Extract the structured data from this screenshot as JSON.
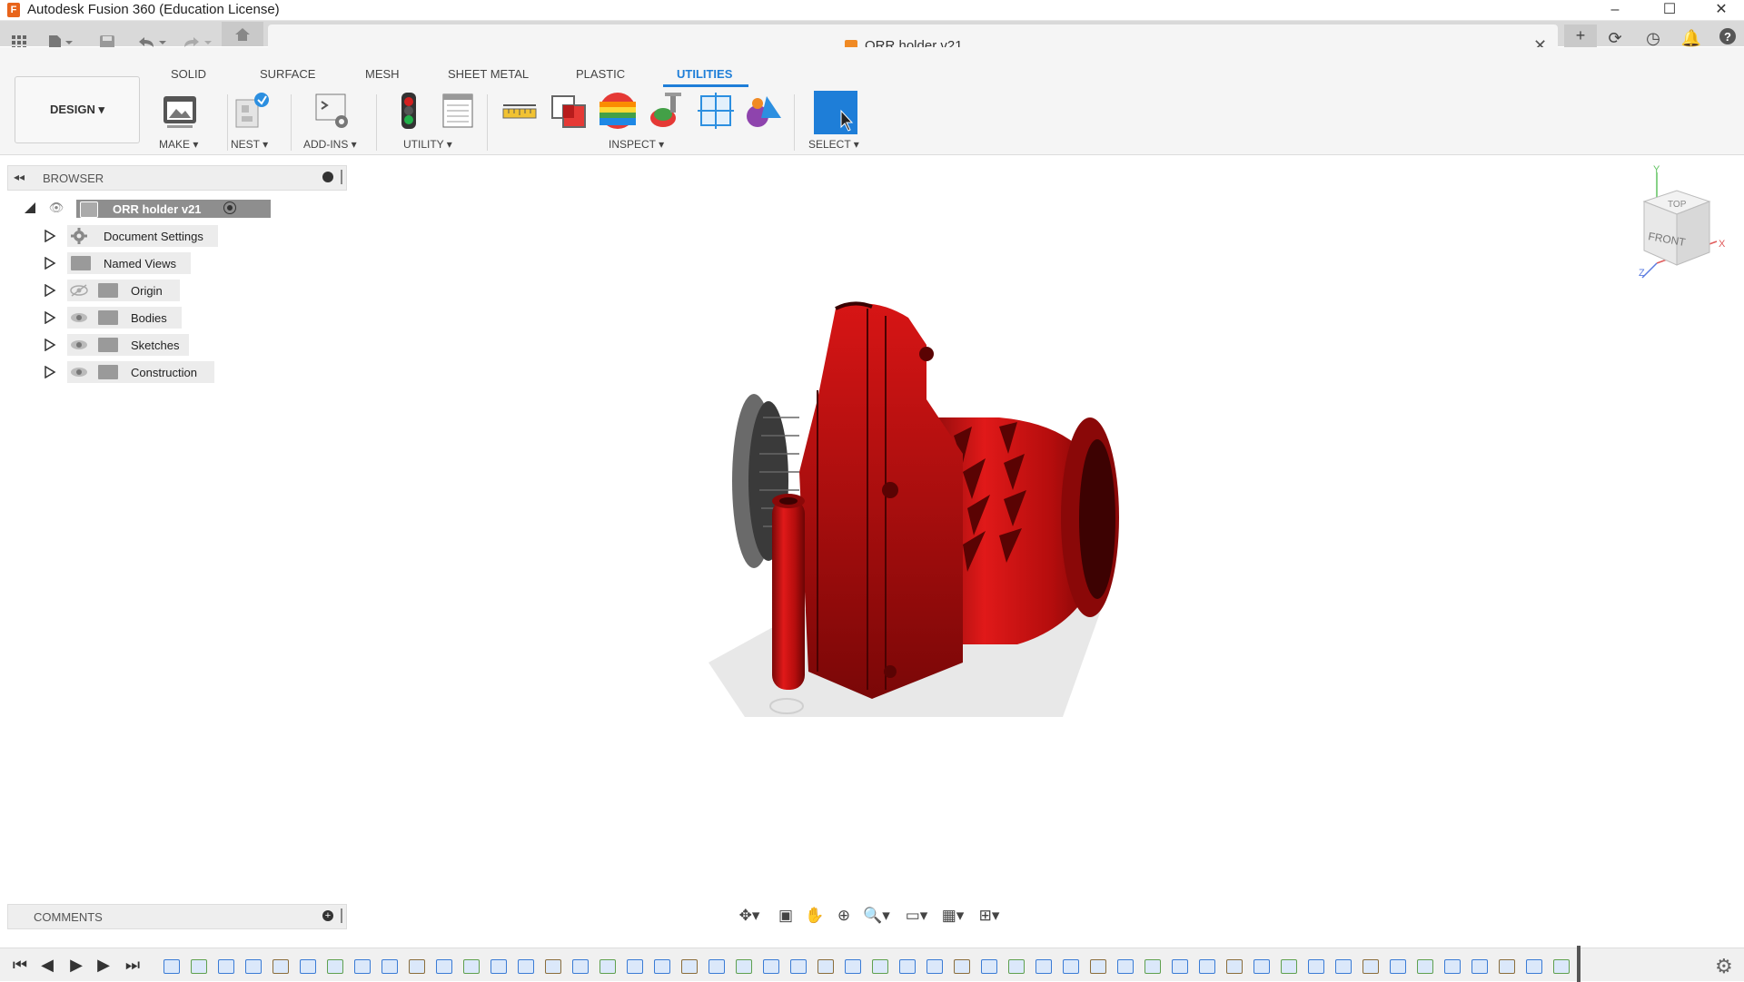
{
  "window": {
    "title": "Autodesk Fusion 360 (Education License)",
    "logo_letter": "F",
    "minimize": "–",
    "maximize": "☐",
    "close": "✕"
  },
  "document": {
    "title": "ORR holder v21",
    "close": "✕"
  },
  "ribbon": {
    "workspace": "DESIGN ▾",
    "tabs": [
      "SOLID",
      "SURFACE",
      "MESH",
      "SHEET METAL",
      "PLASTIC",
      "UTILITIES"
    ],
    "active_tab": "UTILITIES",
    "groups": {
      "make": "MAKE ▾",
      "nest": "NEST ▾",
      "addins": "ADD-INS ▾",
      "utility": "UTILITY ▾",
      "inspect": "INSPECT ▾",
      "select": "SELECT ▾"
    }
  },
  "browser": {
    "title": "BROWSER",
    "root": "ORR holder v21",
    "items": [
      {
        "label": "Document Settings",
        "icon": "gear-icon"
      },
      {
        "label": "Named Views",
        "icon": "folder-icon"
      },
      {
        "label": "Origin",
        "icon": "folder-icon",
        "eye": "hidden"
      },
      {
        "label": "Bodies",
        "icon": "folder-icon",
        "eye": "visible"
      },
      {
        "label": "Sketches",
        "icon": "folder-icon",
        "eye": "visible"
      },
      {
        "label": "Construction",
        "icon": "folder-icon",
        "eye": "visible"
      }
    ]
  },
  "comments": {
    "title": "COMMENTS"
  },
  "viewcube": {
    "top": "TOP",
    "front": "FRONT",
    "axis_x": "X",
    "axis_y": "Y",
    "axis_z": "Z"
  },
  "colors": {
    "accent": "#1e7ed8",
    "model": "#cc1111",
    "ribbon_bg": "#f5f5f5"
  }
}
